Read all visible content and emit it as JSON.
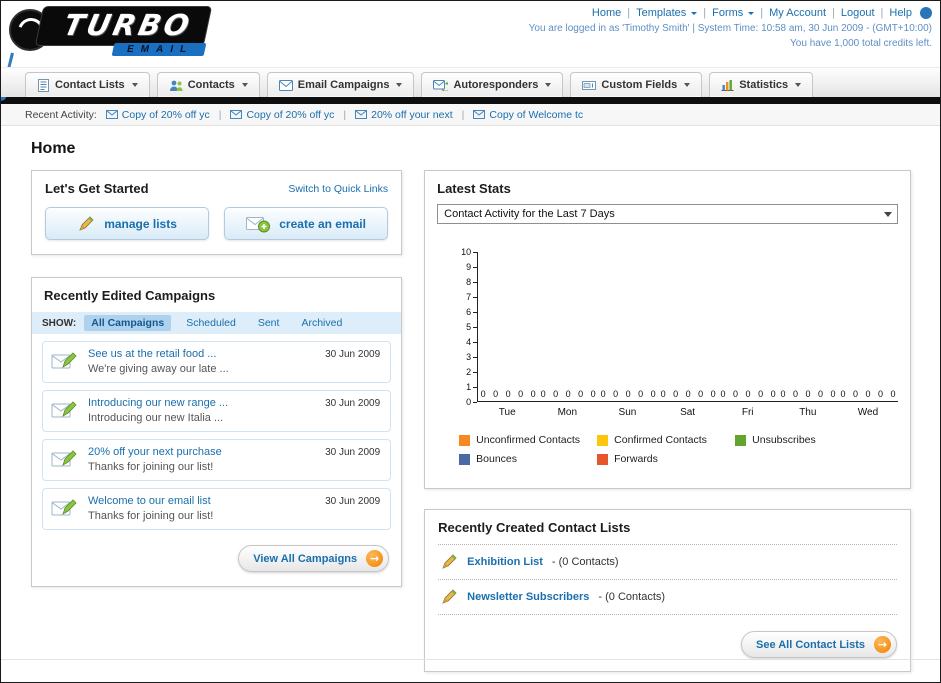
{
  "header": {
    "logo": {
      "primary": "TURBO",
      "secondary": "EMAIL"
    },
    "nav_links": [
      {
        "label": "Home"
      },
      {
        "label": "Templates"
      },
      {
        "label": "Forms"
      },
      {
        "label": "My Account"
      },
      {
        "label": "Logout"
      },
      {
        "label": "Help"
      }
    ],
    "login_status": "You are logged in as 'Timothy Smith' | System Time: 10:58 am, 30 Jun 2009 - (GMT+10:00)",
    "credits_status": "You have 1,000 total credits left."
  },
  "main_nav": {
    "items": [
      {
        "label": "Contact Lists",
        "icon": "contact-lists-icon"
      },
      {
        "label": "Contacts",
        "icon": "contacts-icon"
      },
      {
        "label": "Email Campaigns",
        "icon": "email-campaigns-icon"
      },
      {
        "label": "Autoresponders",
        "icon": "autoresponders-icon"
      },
      {
        "label": "Custom Fields",
        "icon": "custom-fields-icon"
      },
      {
        "label": "Statistics",
        "icon": "statistics-icon"
      }
    ]
  },
  "recent_activity": {
    "label": "Recent Activity:",
    "items": [
      {
        "title": "Copy of 20% off yc"
      },
      {
        "title": "Copy of 20% off yc"
      },
      {
        "title": "20% off your next"
      },
      {
        "title": "Copy of Welcome tc"
      }
    ]
  },
  "page_title": "Home",
  "get_started": {
    "title": "Let's Get Started",
    "switch_link": "Switch to Quick Links",
    "manage_lists_label": "manage lists",
    "create_email_label": "create an email"
  },
  "campaigns": {
    "title": "Recently Edited Campaigns",
    "show_label": "SHOW:",
    "filters": [
      {
        "label": "All Campaigns",
        "active": true
      },
      {
        "label": "Scheduled",
        "active": false
      },
      {
        "label": "Sent",
        "active": false
      },
      {
        "label": "Archived",
        "active": false
      }
    ],
    "items": [
      {
        "title": "See us at the retail food ...",
        "subtitle": "We're giving away our late ...",
        "date": "30 Jun 2009"
      },
      {
        "title": "Introducing our new range ...",
        "subtitle": "Introducing our new Italia ...",
        "date": "30 Jun 2009"
      },
      {
        "title": "20% off your next purchase",
        "subtitle": "Thanks for joining our list!",
        "date": "30 Jun 2009"
      },
      {
        "title": "Welcome to our email list",
        "subtitle": "Thanks for joining our list!",
        "date": "30 Jun 2009"
      }
    ],
    "view_all_label": "View All Campaigns"
  },
  "stats": {
    "title": "Latest Stats",
    "period_select_value": "Contact Activity for the Last 7 Days",
    "chart_data": {
      "type": "bar",
      "title": "Contact Activity for the Last 7 Days",
      "categories": [
        "Tue",
        "Mon",
        "Sun",
        "Sat",
        "Fri",
        "Thu",
        "Wed"
      ],
      "series": [
        {
          "name": "Unconfirmed Contacts",
          "color": "#f6891f",
          "values": [
            0,
            0,
            0,
            0,
            0,
            0,
            0
          ]
        },
        {
          "name": "Confirmed Contacts",
          "color": "#fdc50d",
          "values": [
            0,
            0,
            0,
            0,
            0,
            0,
            0
          ]
        },
        {
          "name": "Unsubscribes",
          "color": "#61a52f",
          "values": [
            0,
            0,
            0,
            0,
            0,
            0,
            0
          ]
        },
        {
          "name": "Bounces",
          "color": "#4a69a5",
          "values": [
            0,
            0,
            0,
            0,
            0,
            0,
            0
          ]
        },
        {
          "name": "Forwards",
          "color": "#e7552c",
          "values": [
            0,
            0,
            0,
            0,
            0,
            0,
            0
          ]
        }
      ],
      "ylim": [
        0,
        10
      ],
      "y_ticks": [
        10,
        9,
        8,
        7,
        6,
        5,
        4,
        3,
        2,
        1,
        0
      ],
      "grid": false,
      "legend_position": "bottom"
    }
  },
  "contact_lists": {
    "title": "Recently Created Contact Lists",
    "items": [
      {
        "name": "Exhibition List",
        "detail": "- (0 Contacts)"
      },
      {
        "name": "Newsletter Subscribers",
        "detail": "- (0 Contacts)"
      }
    ],
    "see_all_label": "See All Contact Lists"
  },
  "colors": {
    "link": "#1a6fad",
    "accent_orange": "#f7941d",
    "nav_bar_dark": "#0e0e0e",
    "logo_blue": "#1b6fc0"
  }
}
